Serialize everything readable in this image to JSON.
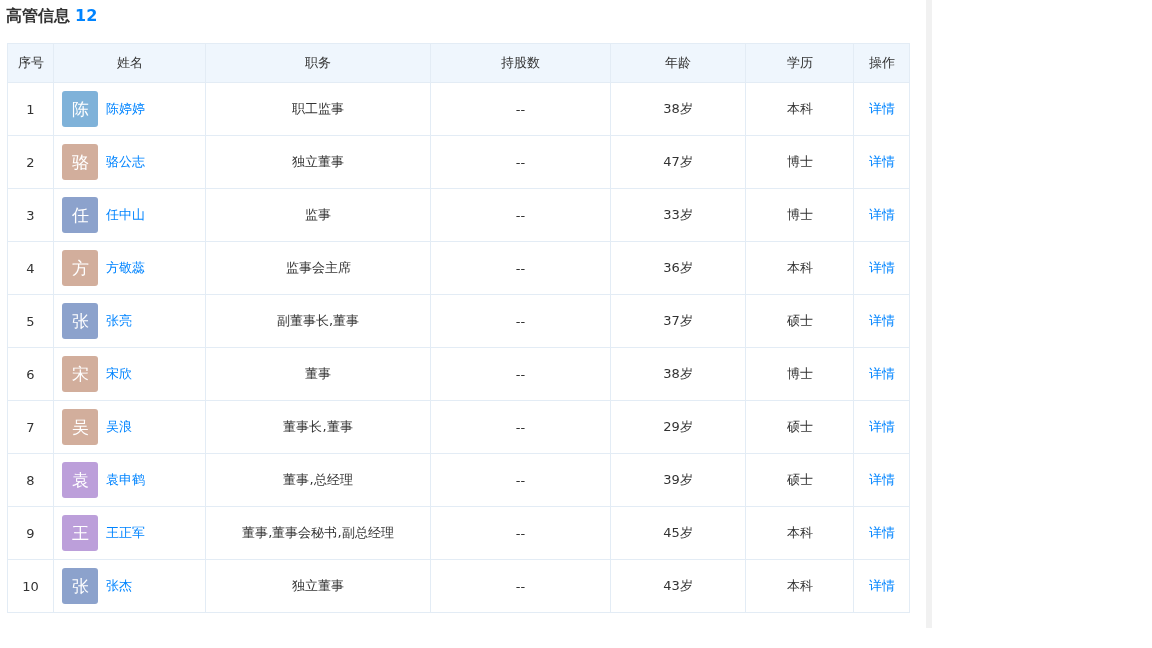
{
  "title": {
    "text": "高管信息",
    "count": "12"
  },
  "table": {
    "columns": [
      "序号",
      "姓名",
      "职务",
      "持股数",
      "年龄",
      "学历",
      "操作"
    ],
    "rows": [
      {
        "index": "1",
        "avatar": "陈",
        "color": "#7fb2d9",
        "name": "陈婷婷",
        "position": "职工监事",
        "shares": "--",
        "age": "38岁",
        "education": "本科",
        "action": "详情"
      },
      {
        "index": "2",
        "avatar": "骆",
        "color": "#d2ae9c",
        "name": "骆公志",
        "position": "独立董事",
        "shares": "--",
        "age": "47岁",
        "education": "博士",
        "action": "详情"
      },
      {
        "index": "3",
        "avatar": "任",
        "color": "#8ca2cc",
        "name": "任中山",
        "position": "监事",
        "shares": "--",
        "age": "33岁",
        "education": "博士",
        "action": "详情"
      },
      {
        "index": "4",
        "avatar": "方",
        "color": "#d2ae9c",
        "name": "方敬蕊",
        "position": "监事会主席",
        "shares": "--",
        "age": "36岁",
        "education": "本科",
        "action": "详情"
      },
      {
        "index": "5",
        "avatar": "张",
        "color": "#8ca2cc",
        "name": "张亮",
        "position": "副董事长,董事",
        "shares": "--",
        "age": "37岁",
        "education": "硕士",
        "action": "详情"
      },
      {
        "index": "6",
        "avatar": "宋",
        "color": "#d2ae9c",
        "name": "宋欣",
        "position": "董事",
        "shares": "--",
        "age": "38岁",
        "education": "博士",
        "action": "详情"
      },
      {
        "index": "7",
        "avatar": "吴",
        "color": "#d2ae9c",
        "name": "吴浪",
        "position": "董事长,董事",
        "shares": "--",
        "age": "29岁",
        "education": "硕士",
        "action": "详情"
      },
      {
        "index": "8",
        "avatar": "袁",
        "color": "#bc9fda",
        "name": "袁申鹤",
        "position": "董事,总经理",
        "shares": "--",
        "age": "39岁",
        "education": "硕士",
        "action": "详情"
      },
      {
        "index": "9",
        "avatar": "王",
        "color": "#bc9fda",
        "name": "王正军",
        "position": "董事,董事会秘书,副总经理",
        "shares": "--",
        "age": "45岁",
        "education": "本科",
        "action": "详情"
      },
      {
        "index": "10",
        "avatar": "张",
        "color": "#8ca2cc",
        "name": "张杰",
        "position": "独立董事",
        "shares": "--",
        "age": "43岁",
        "education": "本科",
        "action": "详情"
      }
    ]
  }
}
